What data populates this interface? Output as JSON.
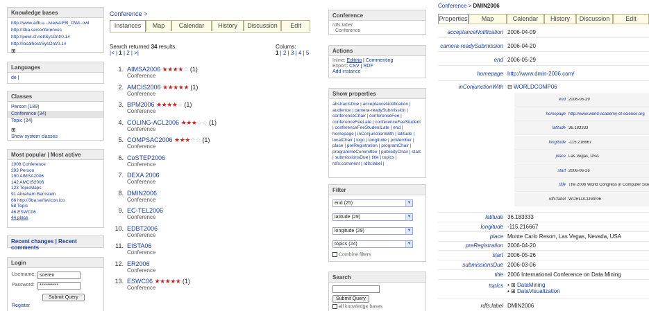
{
  "kb_box": {
    "title": "Knowledge bases",
    "items": [
      "http://www.aifb.u.../viewAIFB_OWL.owl",
      "http://3ba.se/conferences",
      "http://powl.sf.net/SysOnt/0.1#",
      "http://localhost/SysOnt/0.1#"
    ],
    "expand": "⊞"
  },
  "lang_box": {
    "title": "Languages",
    "item": "de |"
  },
  "classes_box": {
    "title": "Classes",
    "items": [
      "Person (189)",
      "Conference (34)",
      "Topic (24)"
    ],
    "expand": "⊞",
    "show_system": "Show system classes"
  },
  "popular_box": {
    "title": "Most popular | Most active",
    "items": [
      "1008 Conference",
      "293 Person",
      "190 AIMSA2006",
      "142 AMCIS2006",
      "123 TopicMaps",
      "91 Abraham Bernstein",
      "66 http://3ba.se/favicon.ico",
      "58 Topic",
      "46 ESWC06",
      "44 place"
    ]
  },
  "recent_box": {
    "title": "Recent changes | Recent comments"
  },
  "login_box": {
    "title": "Login",
    "username_label": "Username:",
    "username_value": "soeren",
    "password_label": "Password:",
    "password_value": "**********",
    "submit": "Submit Query",
    "register": "Register"
  },
  "center": {
    "breadcrumb": "Conference >",
    "tabs": [
      "Instances",
      "Map",
      "Calendar",
      "History",
      "Discussion",
      "Edit"
    ],
    "search_prefix": "Search returned ",
    "search_count": "34",
    "search_suffix": " results.",
    "pager_prev": "|< | ",
    "pager_current": "1",
    "pager_rest": " | 2 | >|",
    "columns_label": "Colums:",
    "columns_current": "1",
    "columns_rest": " | 2 | 3 | 4 | 5",
    "results": [
      {
        "num": "1.",
        "name": "AIMSA2006",
        "stars": 4,
        "count": "(1)",
        "sub": "Conference"
      },
      {
        "num": "2.",
        "name": "AMCIS2006",
        "stars": 5,
        "count": "(1)",
        "sub": "Conference"
      },
      {
        "num": "3.",
        "name": "BPM2006",
        "stars": 4,
        "count": "(1)",
        "sub": "Conference"
      },
      {
        "num": "4.",
        "name": "COLING-ACL2006",
        "stars": 3,
        "count": "(1)",
        "sub": "Conference"
      },
      {
        "num": "5.",
        "name": "COMPSAC2006",
        "stars": 3,
        "count": "(1)",
        "sub": "Conference"
      },
      {
        "num": "6.",
        "name": "CoSTEP2006",
        "stars": 0,
        "count": "",
        "sub": "Conference"
      },
      {
        "num": "7.",
        "name": "DEXA 2006",
        "stars": 0,
        "count": "",
        "sub": "Conference"
      },
      {
        "num": "8.",
        "name": "DMIN2006",
        "stars": 0,
        "count": "",
        "sub": "Conference"
      },
      {
        "num": "9.",
        "name": "EC-TEL2006",
        "stars": 0,
        "count": "",
        "sub": "Conference"
      },
      {
        "num": "10.",
        "name": "EDBT2006",
        "stars": 0,
        "count": "",
        "sub": "Conference"
      },
      {
        "num": "11.",
        "name": "EISTA06",
        "stars": 0,
        "count": "",
        "sub": "Conference"
      },
      {
        "num": "12.",
        "name": "ER2006",
        "stars": 0,
        "count": "",
        "sub": "Conference"
      },
      {
        "num": "13.",
        "name": "ESWC06",
        "stars": 5,
        "count": "(1)",
        "sub": "Conference"
      }
    ]
  },
  "conf_box": {
    "title": "Conference",
    "label": "rdfs:label",
    "value": "Conference"
  },
  "actions_box": {
    "title": "Actions",
    "inline_label": "Inline: ",
    "inline_editing": "Editing",
    "inline_sep": " | ",
    "inline_commenting": "Commenting",
    "export_label": "Export: ",
    "export_csv": "CSV",
    "export_sep": " | ",
    "export_rdf": "RDF",
    "add_instance": "Add instance"
  },
  "showprops_box": {
    "title": "Show properties",
    "text": "abstractsDue | acceptanceNotification | audience | camera-readySubmission | conferenceChair | conferenceFee | conferenceFeeLate | conferenceFeeStudent | conferenceFeeStudentLate | end | homepage | inConjunctionWith | latitude | localChair | logo | longitude | pcMember | place | preRegistration | programChair | programmeCommittee | publicityChair | start | submissionsDue | title | topics | rdfs:comment | rdfs:label |"
  },
  "filter_box": {
    "title": "Filter",
    "selects": [
      "end (25)",
      "latitude (29)",
      "longitude (29)",
      "topics (24)"
    ],
    "combine": "Combine filters"
  },
  "search_box": {
    "title": "Search",
    "submit": "Submit Query",
    "all_kb": "all knowledge bases"
  },
  "right": {
    "breadcrumb_prefix": "Conference > ",
    "breadcrumb_current": "DMIN2006",
    "tabs": [
      "Properties",
      "Map",
      "Calendar",
      "History",
      "Discussion",
      "Edit"
    ],
    "props": [
      {
        "k": "acceptanceNotification",
        "v": "2006-04-09"
      },
      {
        "k": "camera-readySubmission",
        "v": "2006-04-20"
      },
      {
        "k": "end",
        "v": "2006-05-29"
      },
      {
        "k": "homepage",
        "v": "http://www.dmin-2006.com/",
        "link": true
      }
    ],
    "inconj": {
      "k": "inConjunctionWith",
      "expand": "⊟",
      "v": "WORLDCOMP06",
      "nested": [
        {
          "k": "end",
          "v": "2006-06-29"
        },
        {
          "k": "homepage",
          "v": "http://www.world-academy-of-science.org",
          "link": true
        },
        {
          "k": "latitude",
          "v": "36.183333"
        },
        {
          "k": "longitude",
          "v": "-115.216667"
        },
        {
          "k": "place",
          "v": "Las Vegas, USA"
        },
        {
          "k": "start",
          "v": "2006-06-26"
        },
        {
          "k": "title",
          "v": "The 2006 World Congress in Computer Science"
        },
        {
          "k": "rdfs:label",
          "v": "WORLDCOMP06",
          "nat": true
        }
      ]
    },
    "props2": [
      {
        "k": "latitude",
        "v": "36.183333"
      },
      {
        "k": "longitude",
        "v": "-115.216667"
      },
      {
        "k": "place",
        "v": "Monte Carlo Resort, Las Vegas, Nevada, USA"
      },
      {
        "k": "preRegistration",
        "v": "2006-04-20"
      },
      {
        "k": "start",
        "v": "2006-05-26"
      },
      {
        "k": "submissionsDue",
        "v": "2006-03-06"
      },
      {
        "k": "title",
        "v": "2006 International Conference on Data Mining"
      }
    ],
    "topics": {
      "k": "topics",
      "items": [
        "DataMining",
        "DataVisualization"
      ],
      "expand": "⊞"
    },
    "label_row": {
      "k": "rdfs:label",
      "v": "DMIN2006"
    }
  }
}
